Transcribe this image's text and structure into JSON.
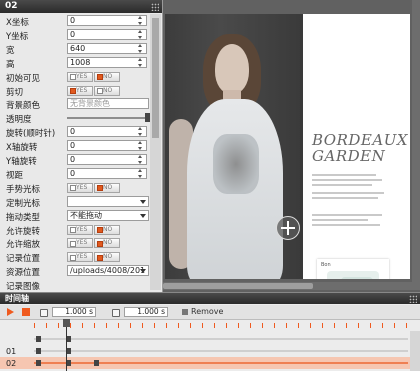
{
  "panel": {
    "title": "02",
    "props": [
      {
        "label": "X坐标",
        "value": "0",
        "kind": "number"
      },
      {
        "label": "Y坐标",
        "value": "0",
        "kind": "number"
      },
      {
        "label": "宽",
        "value": "640",
        "kind": "number"
      },
      {
        "label": "高",
        "value": "1008",
        "kind": "number"
      },
      {
        "label": "初始可见",
        "kind": "toggle",
        "selected": "no"
      },
      {
        "label": "剪切",
        "kind": "toggle",
        "selected": "yes"
      },
      {
        "label": "背景颜色",
        "value": "无背景颜色",
        "kind": "text"
      },
      {
        "label": "透明度",
        "kind": "slider",
        "level": 1.0
      },
      {
        "label": "旋转(顺时针)",
        "value": "0",
        "kind": "number"
      },
      {
        "label": "X轴旋转",
        "value": "0",
        "kind": "number"
      },
      {
        "label": "Y轴旋转",
        "value": "0",
        "kind": "number"
      },
      {
        "label": "视距",
        "value": "0",
        "kind": "number"
      },
      {
        "label": "手势光标",
        "kind": "toggle",
        "selected": "no"
      },
      {
        "label": "定制光标",
        "value": "",
        "kind": "select"
      },
      {
        "label": "拖动类型",
        "value": "不能拖动",
        "kind": "select"
      },
      {
        "label": "允许旋转",
        "kind": "toggle",
        "selected": "no"
      },
      {
        "label": "允许缩放",
        "kind": "toggle",
        "selected": "no"
      },
      {
        "label": "记录位置",
        "kind": "toggle",
        "selected": "no"
      },
      {
        "label": "资源位置",
        "value": "/uploads/4008/201",
        "kind": "select"
      },
      {
        "label": "记录图像",
        "kind": "none"
      }
    ],
    "yes_label": "YES",
    "no_label": "NO"
  },
  "stage": {
    "brand_line1": "BORDEAUX",
    "brand_line2": "GARDEN",
    "sample_tag": "Bon"
  },
  "timeline": {
    "title": "时间轴",
    "start_time": "1.000 s",
    "end_time": "1.000 s",
    "remove_label": "Remove",
    "rows": [
      {
        "label": "",
        "active": false
      },
      {
        "label": "01",
        "active": false
      },
      {
        "label": "02",
        "active": true
      }
    ]
  },
  "colors": {
    "accent": "#ef5a1f",
    "panel_header": "#2f2f2f",
    "stage_bg": "#616161"
  }
}
